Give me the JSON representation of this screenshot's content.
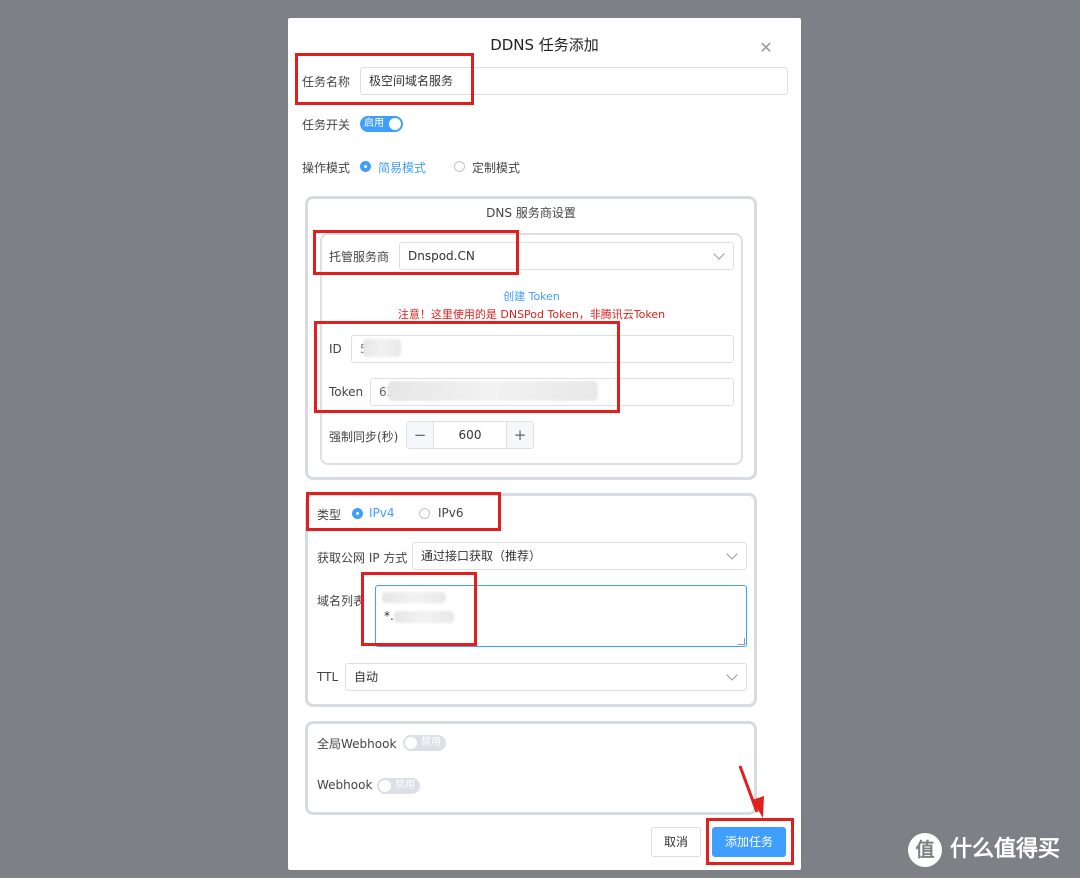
{
  "dialog": {
    "title": "DDNS 任务添加",
    "close_icon": "close-icon"
  },
  "task": {
    "name_label": "任务名称",
    "name_value": "极空间域名服务",
    "switch_label": "任务开关",
    "switch_text": "启用",
    "mode_label": "操作模式",
    "mode_simple": "简易模式",
    "mode_custom": "定制模式"
  },
  "dns": {
    "section_title": "DNS 服务商设置",
    "provider_label": "托管服务商",
    "provider_value": "Dnspod.CN",
    "create_token": "创建 Token",
    "warning": "注意！这里使用的是 DNSPod Token，非腾讯云Token",
    "id_label": "ID",
    "id_value_prefix": "5",
    "token_label": "Token",
    "token_value_prefix": "63",
    "sync_label": "强制同步(秒)",
    "sync_value": "600",
    "minus": "−",
    "plus": "+"
  },
  "ip": {
    "type_label": "类型",
    "ipv4": "IPv4",
    "ipv6": "IPv6",
    "method_label": "获取公网 IP 方式",
    "method_value": "通过接口获取（推荐）",
    "domain_label": "域名列表",
    "domain_line2_prefix": "*.",
    "ttl_label": "TTL",
    "ttl_value": "自动"
  },
  "webhook": {
    "global_label": "全局Webhook",
    "global_toggle": "禁用",
    "label": "Webhook",
    "toggle": "禁用"
  },
  "footer": {
    "cancel": "取消",
    "submit": "添加任务"
  },
  "watermark": {
    "icon": "值",
    "text": "什么值得买"
  },
  "colors": {
    "accent": "#409eff",
    "annotation": "#e0201e",
    "warning": "#e0201e"
  }
}
